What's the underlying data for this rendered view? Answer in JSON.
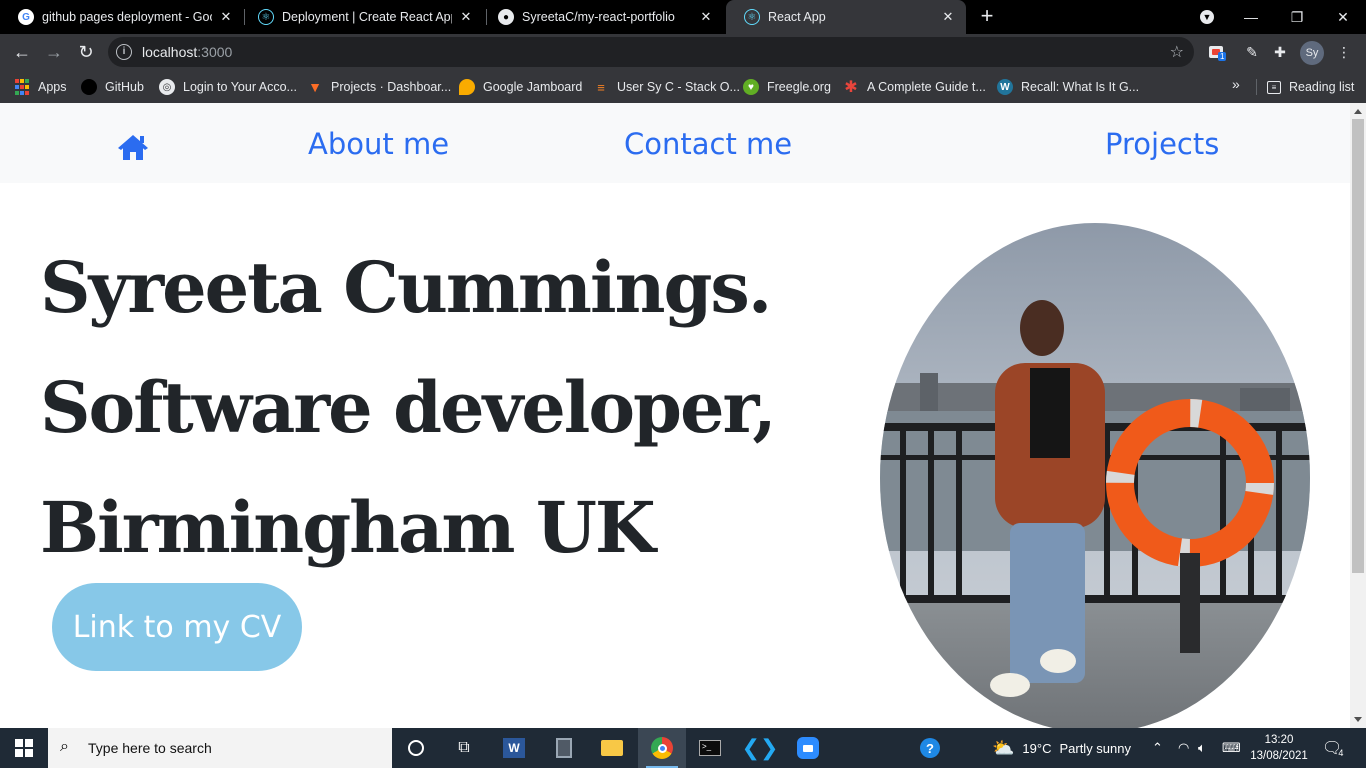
{
  "browser": {
    "tabs": [
      {
        "title": "github pages deployment - Goog",
        "icon": "google-icon"
      },
      {
        "title": "Deployment | Create React App",
        "icon": "react-icon"
      },
      {
        "title": "SyreetaC/my-react-portfolio",
        "icon": "github-icon"
      },
      {
        "title": "React App",
        "icon": "react-icon"
      }
    ],
    "active_tab": 3,
    "address": {
      "host": "localhost",
      "port": ":3000"
    },
    "profile_initials": "Sy",
    "extension_badge": "1",
    "bookmarks": [
      {
        "label": "Apps",
        "icon": "apps-grid-icon"
      },
      {
        "label": "GitHub",
        "icon": "github-icon"
      },
      {
        "label": "Login to Your Acco...",
        "icon": "globe-icon"
      },
      {
        "label": "Projects · Dashboar...",
        "icon": "gitlab-icon"
      },
      {
        "label": "Google Jamboard",
        "icon": "jamboard-icon"
      },
      {
        "label": "User Sy C - Stack O...",
        "icon": "stackoverflow-icon"
      },
      {
        "label": "Freegle.org",
        "icon": "freegle-icon"
      },
      {
        "label": "A Complete Guide t...",
        "icon": "asterisk-icon"
      },
      {
        "label": "Recall: What Is It G...",
        "icon": "wordpress-icon"
      }
    ],
    "bookmarks_more": "»",
    "reading_list": "Reading list"
  },
  "site": {
    "nav": {
      "home_icon": "home-icon",
      "about": "About me",
      "contact": "Contact me",
      "projects": "Projects"
    },
    "hero_lines": [
      "Syreeta Cummings.",
      "Software developer,",
      "Birmingham UK"
    ],
    "cv_button": "Link to my CV",
    "photo_icon": "profile-photo"
  },
  "taskbar": {
    "search_placeholder": "Type here to search",
    "weather": {
      "temp": "19°C",
      "condition": "Partly sunny"
    },
    "time": "13:20",
    "date": "13/08/2021",
    "notifications": "4"
  },
  "colors": {
    "nav_link": "#2b6cf0",
    "hero_text": "#212529",
    "cv_button_bg": "#87c8e8",
    "nav_bg": "#f8f9fa"
  }
}
